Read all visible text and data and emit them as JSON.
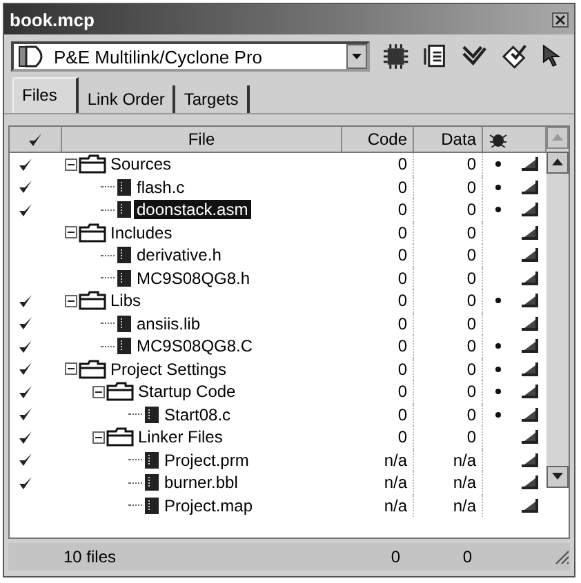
{
  "window": {
    "title": "book.mcp"
  },
  "toolbar": {
    "target": "P&E Multilink/Cyclone Pro"
  },
  "tabs": [
    {
      "label": "Files",
      "selected": true
    },
    {
      "label": "Link Order",
      "selected": false
    },
    {
      "label": "Targets",
      "selected": false
    }
  ],
  "columns": [
    "File",
    "Code",
    "Data"
  ],
  "files": [
    {
      "kind": "group",
      "name": "Sources",
      "checked": true,
      "expanded": true,
      "code": "0",
      "data": "0",
      "debug": true,
      "selected": false,
      "children": [
        {
          "kind": "file",
          "name": "flash.c",
          "checked": true,
          "code": "0",
          "data": "0",
          "debug": true,
          "selected": false
        },
        {
          "kind": "file",
          "name": "doonstack.asm",
          "checked": true,
          "code": "0",
          "data": "0",
          "debug": true,
          "selected": true
        }
      ]
    },
    {
      "kind": "group",
      "name": "Includes",
      "checked": false,
      "expanded": true,
      "code": "0",
      "data": "0",
      "debug": false,
      "selected": false,
      "children": [
        {
          "kind": "file",
          "name": "derivative.h",
          "checked": false,
          "code": "0",
          "data": "0",
          "debug": false,
          "selected": false
        },
        {
          "kind": "file",
          "name": "MC9S08QG8.h",
          "checked": false,
          "code": "0",
          "data": "0",
          "debug": false,
          "selected": false
        }
      ]
    },
    {
      "kind": "group",
      "name": "Libs",
      "checked": true,
      "expanded": true,
      "code": "0",
      "data": "0",
      "debug": true,
      "selected": false,
      "children": [
        {
          "kind": "file",
          "name": "ansiis.lib",
          "checked": true,
          "code": "0",
          "data": "0",
          "debug": false,
          "selected": false
        },
        {
          "kind": "file",
          "name": "MC9S08QG8.C",
          "checked": true,
          "code": "0",
          "data": "0",
          "debug": true,
          "selected": false
        }
      ]
    },
    {
      "kind": "group",
      "name": "Project Settings",
      "checked": true,
      "expanded": true,
      "code": "0",
      "data": "0",
      "debug": true,
      "selected": false,
      "children": [
        {
          "kind": "group",
          "name": "Startup Code",
          "checked": true,
          "expanded": true,
          "code": "0",
          "data": "0",
          "debug": true,
          "selected": false,
          "children": [
            {
              "kind": "file",
              "name": "Start08.c",
              "checked": true,
              "code": "0",
              "data": "0",
              "debug": true,
              "selected": false
            }
          ]
        },
        {
          "kind": "group",
          "name": "Linker Files",
          "checked": true,
          "expanded": true,
          "code": "0",
          "data": "0",
          "debug": false,
          "selected": false,
          "children": [
            {
              "kind": "file",
              "name": "Project.prm",
              "checked": true,
              "code": "n/a",
              "data": "n/a",
              "debug": false,
              "selected": false
            },
            {
              "kind": "file",
              "name": "burner.bbl",
              "checked": true,
              "code": "n/a",
              "data": "n/a",
              "debug": false,
              "selected": false
            },
            {
              "kind": "file",
              "name": "Project.map",
              "checked": false,
              "code": "n/a",
              "data": "n/a",
              "debug": false,
              "selected": false
            }
          ]
        }
      ]
    }
  ],
  "status_bar": {
    "count": "10 files",
    "code": "0",
    "data": "0"
  }
}
